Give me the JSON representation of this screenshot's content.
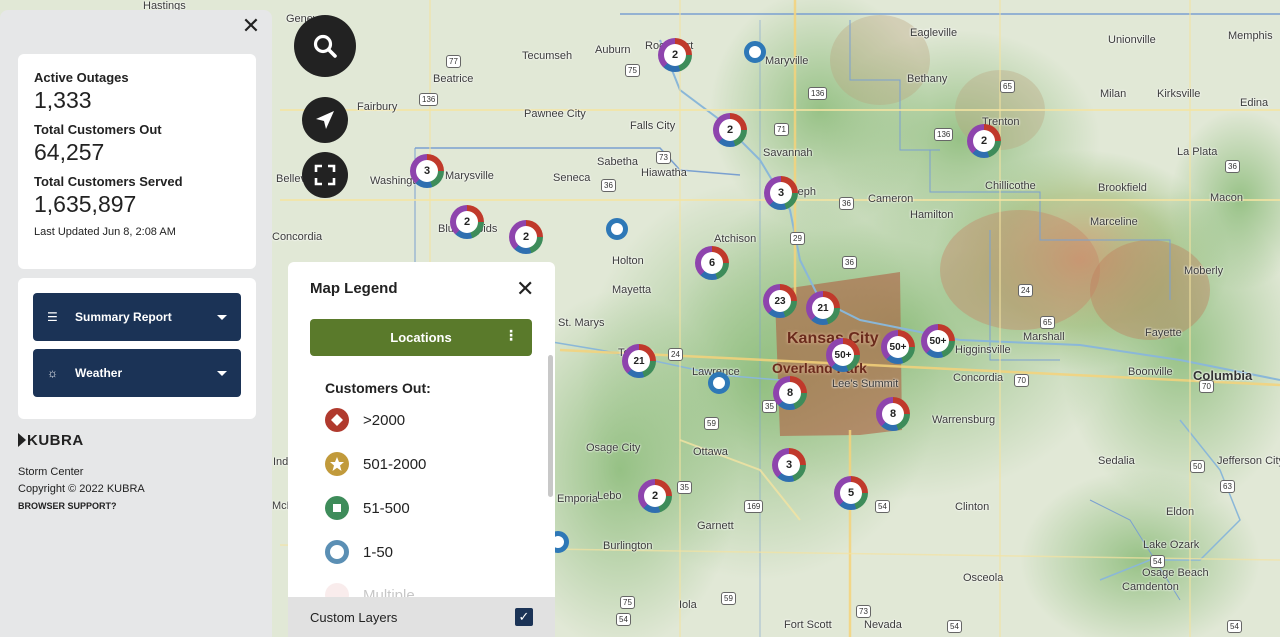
{
  "stats": {
    "active_outages_label": "Active Outages",
    "active_outages": "1,333",
    "customers_out_label": "Total Customers Out",
    "customers_out": "64,257",
    "customers_served_label": "Total Customers Served",
    "customers_served": "1,635,897",
    "last_updated": "Last Updated  Jun 8, 2:08 AM"
  },
  "menus": {
    "summary_label": "Summary Report",
    "weather_label": "Weather"
  },
  "brand": {
    "name": "KUBRA"
  },
  "footer": {
    "app": "Storm Center",
    "copyright": "Copyright © 2022 KUBRA",
    "browser_support": "BROWSER SUPPORT?"
  },
  "legend": {
    "title": "Map Legend",
    "locations_label": "Locations",
    "customers_out_title": "Customers Out:",
    "items": [
      {
        "label": ">2000",
        "color": "#b03a2e",
        "icon": "diamond-icon"
      },
      {
        "label": "501-2000",
        "color": "#c19a3b",
        "icon": "star-icon"
      },
      {
        "label": "51-500",
        "color": "#3e8c5a",
        "icon": "square-icon"
      },
      {
        "label": "1-50",
        "color": "#5b8fb4",
        "icon": "ring-icon"
      },
      {
        "label": "Multiple",
        "color": "#e8b6b6",
        "icon": "multiple-icon"
      }
    ],
    "custom_layers_label": "Custom Layers"
  },
  "clusters": [
    {
      "count": "2"
    },
    {
      "count": "2"
    },
    {
      "count": "2"
    },
    {
      "count": "3"
    },
    {
      "count": "3"
    },
    {
      "count": "2"
    },
    {
      "count": "2"
    },
    {
      "count": "6"
    },
    {
      "count": "23"
    },
    {
      "count": "21"
    },
    {
      "count": "21"
    },
    {
      "count": "50+"
    },
    {
      "count": "50+"
    },
    {
      "count": "50+"
    },
    {
      "count": "8"
    },
    {
      "count": "8"
    },
    {
      "count": "3"
    },
    {
      "count": "2"
    },
    {
      "count": "5"
    }
  ],
  "places": [
    "Hastings",
    "Geneva",
    "Tecumseh",
    "Auburn",
    "Rock Port",
    "Maryville",
    "Eagleville",
    "Unionville",
    "Memphis",
    "Beatrice",
    "Bethany",
    "Fairbury",
    "Pawnee City",
    "Falls City",
    "Milan",
    "Kirksville",
    "Edina",
    "Savannah",
    "Trenton",
    "Sabetha",
    "Hiawatha",
    "La Plata",
    "Marysville",
    "Seneca",
    "St. Joseph",
    "Cameron",
    "Chillicothe",
    "Brookfield",
    "Macon",
    "Belleville",
    "Washington",
    "Hamilton",
    "Concordia",
    "Blue Rapids",
    "Atchison",
    "Marceline",
    "Holton",
    "Moberly",
    "Mayetta",
    "St. Marys",
    "Kansas City",
    "Marshall",
    "Fayette",
    "Topeka",
    "Lawrence",
    "Overland Park",
    "Higginsville",
    "Lee's Summit",
    "Concordia",
    "Boonville",
    "Columbia",
    "Warrensburg",
    "Osage City",
    "Ottawa",
    "Sedalia",
    "Jefferson City",
    "Lebo",
    "Garnett",
    "Clinton",
    "Eldon",
    "Burlington",
    "Lake Ozark",
    "Osage Beach",
    "Osceola",
    "Camdenton",
    "Iola",
    "Fort Scott",
    "Nevada",
    "Ind",
    "McP",
    "Emporia"
  ],
  "shields": [
    "77",
    "136",
    "75",
    "136",
    "73",
    "36",
    "36",
    "71",
    "136",
    "65",
    "36",
    "24",
    "36",
    "29",
    "24",
    "35",
    "70",
    "70",
    "59",
    "169",
    "65",
    "35",
    "54",
    "50",
    "54",
    "75",
    "59",
    "54",
    "54",
    "54",
    "63",
    "73"
  ]
}
